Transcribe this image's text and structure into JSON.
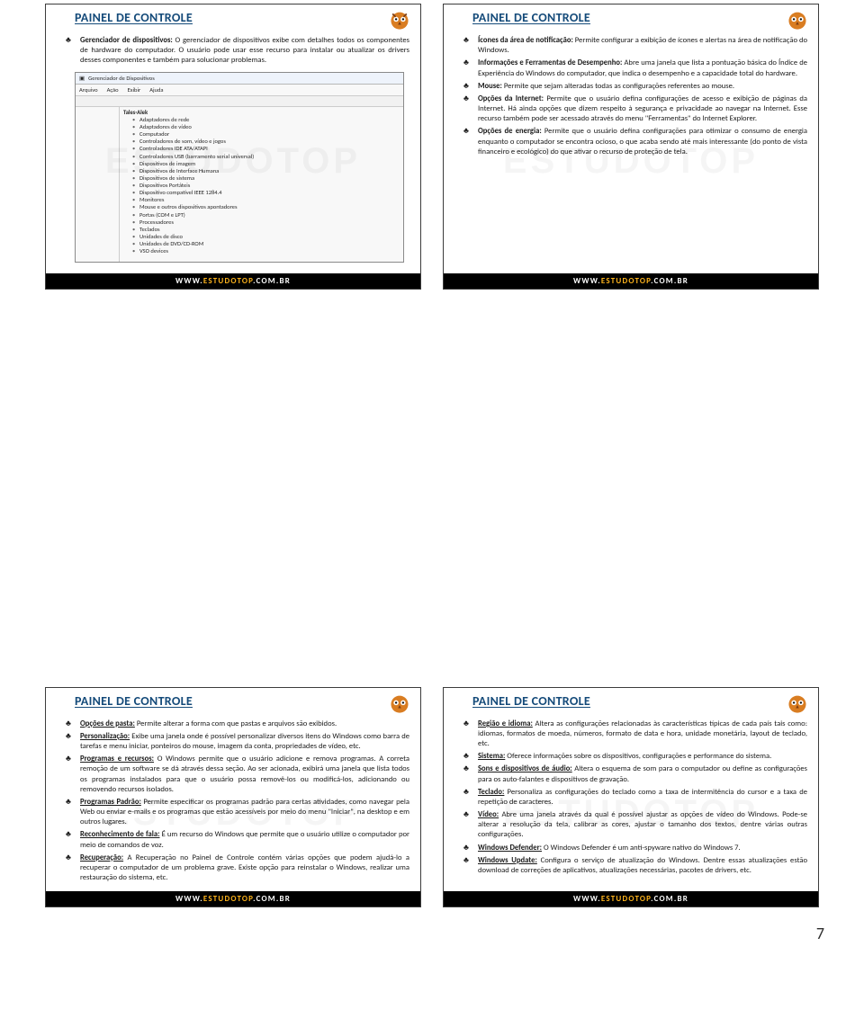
{
  "footer": {
    "www": "WWW.",
    "mid": "ESTUDOTOP",
    "com": ".COM.BR"
  },
  "watermark": "ESTUDOTOP",
  "page_number": "7",
  "common": {
    "title": "PAINEL DE CONTROLE"
  },
  "device_mgr": {
    "title": "Gerenciador de Dispositivos",
    "menu": [
      "Arquivo",
      "Ação",
      "Exibir",
      "Ajuda"
    ],
    "root": "Tales·Alek",
    "items": [
      "Adaptadores de rede",
      "Adaptadores de vídeo",
      "Computador",
      "Controladores de som, vídeo e jogos",
      "Controladores IDE ATA/ATAPI",
      "Controladores USB (barramento serial universal)",
      "Dispositivos de imagem",
      "Dispositivos de Interface Humana",
      "Dispositivos de sistema",
      "Dispositivos Portáteis",
      "Dispositivo compatível IEEE 1284.4",
      "Monitores",
      "Mouse e outros dispositivos apontadores",
      "Portas (COM e LPT)",
      "Processadores",
      "Teclados",
      "Unidades de disco",
      "Unidades de DVD/CD-ROM",
      "VSO devices"
    ]
  },
  "slide1": {
    "b1_lead": "Gerenciador de dispositivos:",
    "b1": " O gerenciador de dispositivos exibe com detalhes todos os componentes de hardware do computador. O usuário pode usar esse recurso para instalar ou atualizar os drivers desses componentes e também para solucionar problemas."
  },
  "slide2": {
    "b1_lead": "Ícones da área de notificação:",
    "b1": " Permite configurar a exibição de ícones e alertas na área de notificação do Windows.",
    "b2_lead": "Informações e Ferramentas de Desempenho:",
    "b2": " Abre uma janela que lista a pontuação básica do Índice de Experiência do Windows do computador, que indica o desempenho e a capacidade total do hardware.",
    "b3_lead": "Mouse:",
    "b3": " Permite que sejam alteradas todas as configurações referentes ao mouse.",
    "b4_lead": "Opções da Internet:",
    "b4": " Permite que o usuário defina configurações de acesso e exibição de páginas da Internet. Há ainda opções que dizem respeito à segurança e privacidade ao navegar na Internet. Esse recurso também pode ser acessado através do menu \"Ferramentas\" do Internet Explorer.",
    "b5_lead": "Opções de energia:",
    "b5": " Permite que o usuário defina configurações para otimizar o consumo de energia enquanto o computador se encontra ocioso, o que acaba sendo até mais interessante (do ponto de vista financeiro e ecológico) do que ativar o recurso de proteção de tela."
  },
  "slide3": {
    "b1_lead": "Opções de pasta:",
    "b1": " Permite alterar a forma com que pastas e arquivos são exibidos.",
    "b2_lead": "Personalização:",
    "b2": " Exibe uma janela onde é possível personalizar diversos itens do Windows como barra de tarefas e menu iniciar, ponteiros do mouse, imagem da conta, propriedades de vídeo, etc.",
    "b3_lead": "Programas e recursos:",
    "b3": " O Windows permite que o usuário adicione e remova programas. A correta remoção de um software se dá através dessa seção. Ao ser acionada, exibirá uma janela que lista todos os programas instalados para que o usuário possa removê-los ou modificá-los, adicionando ou removendo recursos isolados.",
    "b4_lead": "Programas Padrão:",
    "b4": " Permite especificar os programas padrão para certas atividades, como navegar pela Web ou enviar e-mails e os programas que estão acessíveis por meio do menu \"Iniciar\", na desktop e em outros lugares.",
    "b5_lead": "Reconhecimento de fala:",
    "b5": " É um recurso do Windows que permite que o usuário utilize o computador por meio de comandos de voz.",
    "b6_lead": "Recuperação:",
    "b6": " A Recuperação no Painel de Controle contém várias opções que podem ajudá-lo a recuperar o computador de um problema grave. Existe opção para reinstalar o Windows, realizar uma restauração do sistema, etc."
  },
  "slide4": {
    "b1_lead": "Região e idioma:",
    "b1": " Altera as configurações relacionadas às características típicas de cada país tais como: idiomas, formatos de moeda, números, formato de data e hora, unidade monetária, layout de teclado, etc.",
    "b2_lead": "Sistema:",
    "b2": " Oferece informações sobre os dispositivos, configurações e performance do sistema.",
    "b3_lead": "Sons e dispositivos de áudio:",
    "b3": " Altera o esquema de som para o computador ou define as configurações para os auto-falantes e dispositivos de gravação.",
    "b4_lead": "Teclado:",
    "b4": " Personaliza as configurações do teclado como a taxa de intermitência do cursor e a taxa de repetição de caracteres.",
    "b5_lead": "Vídeo:",
    "b5": " Abre uma janela através da qual é possível ajustar as opções de vídeo do Windows. Pode-se alterar a resolução da tela, calibrar as cores, ajustar o tamanho dos textos, dentre várias outras configurações.",
    "b6_lead": "Windows Defender:",
    "b6": " O Windows Defender é um anti-spyware nativo do Windows 7.",
    "b7_lead": "Windows Update:",
    "b7": " Configura o serviço de atualização do Windows. Dentre essas atualizações estão download de correções de aplicativos, atualizações necessárias, pacotes de drivers, etc."
  }
}
